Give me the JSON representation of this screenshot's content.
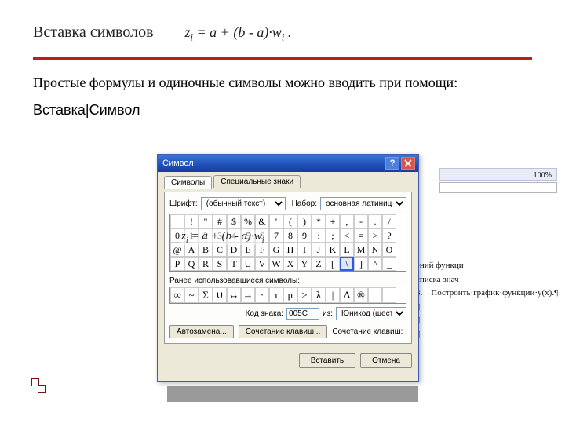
{
  "heading": "Вставка символов",
  "formula_html": "z<sub>i</sub> = a + (b - a)·w<sub>i</sub> .",
  "paragraph": "Простые формулы и одиночные символы можно вводить при помощи:",
  "menu_path": "Вставка|Символ",
  "word_bg": {
    "toolbar_value": "100%",
    "lines": [
      "ений функци",
      "",
      "списка знач",
      "3.→Построить·график·функции·y(x).¶",
      "¶",
      "¶",
      "¶"
    ]
  },
  "dialog": {
    "title": "Символ",
    "tabs": [
      "Символы",
      "Специальные знаки"
    ],
    "active_tab": 0,
    "font_label": "Шрифт:",
    "font_value": "(обычный текст)",
    "set_label": "Набор:",
    "set_value": "основная латиница",
    "grid_rows": [
      [
        " ",
        "!",
        "\"",
        "#",
        "$",
        "%",
        "&",
        "'",
        "(",
        ")",
        "*",
        "+",
        ",",
        "-",
        ".",
        "/"
      ],
      [
        "0",
        "1",
        "2",
        "3",
        "4",
        "5",
        "6",
        "7",
        "8",
        "9",
        ":",
        ";",
        "<",
        "=",
        ">",
        "?"
      ],
      [
        "@",
        "A",
        "B",
        "C",
        "D",
        "E",
        "F",
        "G",
        "H",
        "I",
        "J",
        "K",
        "L",
        "M",
        "N",
        "O"
      ],
      [
        "P",
        "Q",
        "R",
        "S",
        "T",
        "U",
        "V",
        "W",
        "X",
        "Y",
        "Z",
        "[",
        "\\",
        "]",
        "^",
        "_"
      ]
    ],
    "selected_cell": [
      3,
      12
    ],
    "overlay_formula": "z<sub>i</sub> = a + (b - a)·w<sub>i</sub>",
    "recent_label": "Ранее использовавшиеся символы:",
    "recent": [
      "∞",
      "~",
      "Σ",
      "∪",
      "↔",
      "→",
      "·",
      "τ",
      "μ",
      ">",
      "λ",
      "|",
      "Δ",
      "®",
      "",
      ""
    ],
    "code_label": "Код знака:",
    "code_value": "005C",
    "from_label": "из:",
    "from_value": "Юникод (шестн.)",
    "btn_autocorrect": "Автозамена...",
    "btn_shortcut": "Сочетание клавиш...",
    "shortcut_label": "Сочетание клавиш:",
    "btn_insert": "Вставить",
    "btn_cancel": "Отмена"
  }
}
